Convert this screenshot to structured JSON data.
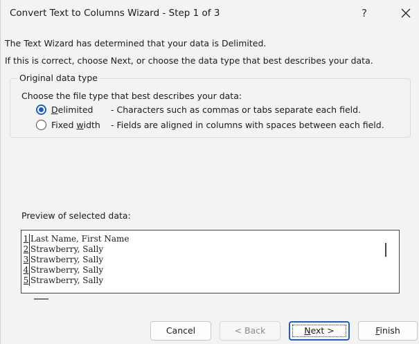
{
  "window": {
    "title": "Convert Text to Columns Wizard - Step 1 of 3",
    "help_label": "?",
    "close_icon": "close-icon"
  },
  "intro": {
    "line1": "The Text Wizard has determined that your data is Delimited.",
    "line2": "If this is correct, choose Next, or choose the data type that best describes your data."
  },
  "original_data_type": {
    "legend": "Original data type",
    "prompt": "Choose the file type that best describes your data:",
    "options": [
      {
        "label_pre": "",
        "label_key": "D",
        "label_post": "elimited",
        "description": "- Characters such as commas or tabs separate each field.",
        "selected": true
      },
      {
        "label_pre": "Fixed ",
        "label_key": "w",
        "label_post": "idth",
        "description": "- Fields are aligned in columns with spaces between each field.",
        "selected": false
      }
    ]
  },
  "preview": {
    "label": "Preview of selected data:",
    "rows": [
      {
        "num": "1",
        "text": "Last Name, First Name"
      },
      {
        "num": "2",
        "text": "Strawberry, Sally"
      },
      {
        "num": "3",
        "text": "Strawberry, Sally"
      },
      {
        "num": "4",
        "text": "Strawberry, Sally"
      },
      {
        "num": "5",
        "text": "Strawberry, Sally"
      }
    ]
  },
  "buttons": {
    "cancel": "Cancel",
    "back": "< Back",
    "next_key": "N",
    "next_rest": "ext >",
    "finish_key": "F",
    "finish_rest": "inish"
  },
  "colors": {
    "accent": "#1f5fb8",
    "background": "#f3f3f3"
  }
}
